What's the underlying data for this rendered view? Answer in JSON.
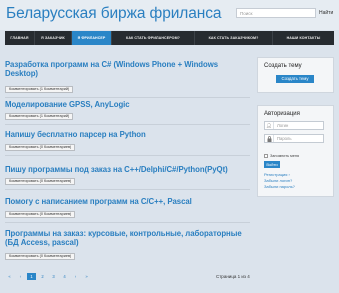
{
  "header": {
    "site_title": "Беларусская биржа фриланса",
    "search_placeholder": "Поиск",
    "search_button": "Найти"
  },
  "nav": {
    "items": [
      {
        "label": "ГЛАВНАЯ",
        "active": false
      },
      {
        "label": "Я ЗАКАЗЧИК",
        "active": false
      },
      {
        "label": "Я ФРИЛАНСЕР",
        "active": true
      },
      {
        "label": "КАК СТАТЬ ФРИЛАНСЕРОМ?",
        "active": false
      },
      {
        "label": "КАК СТАТЬ ЗАКАЗЧИКОМ?",
        "active": false
      },
      {
        "label": "НАШИ КОНТАКТЫ",
        "active": false
      }
    ]
  },
  "posts": [
    {
      "title": "Разработка программ на C# (Windows Phone + Windows Desktop)",
      "comments": "Комментировать (1 Комментарий)"
    },
    {
      "title": "Моделирование GPSS, AnyLogic",
      "comments": "Комментировать (1 Комментарий)"
    },
    {
      "title": "Напишу бесплатно парсер на Python",
      "comments": "Комментировать (0 Комментариев)"
    },
    {
      "title": "Пишу программы под заказ на C++/Delphi/C#/Python(PyQt)",
      "comments": "Комментировать (0 Комментариев)"
    },
    {
      "title": "Помогу с написанием программ на С/С++, Pascal",
      "comments": "Комментировать (0 Комментариев)"
    },
    {
      "title": "Программы на заказ: курсовые, контрольные, лабораторные (БД Access, pascal)",
      "comments": "Комментировать (0 Комментариев)"
    }
  ],
  "pagination": {
    "first": "«",
    "prev": "‹",
    "pages": [
      "1",
      "2",
      "3",
      "4"
    ],
    "current_page": "1",
    "next": "›",
    "last": "»",
    "info": "Страница 1 из 4"
  },
  "sidebar": {
    "create_topic": {
      "title": "Создать тему",
      "button": "Создать тему"
    },
    "auth": {
      "title": "Авторизация",
      "login_placeholder": "Логин",
      "password_placeholder": "Пароль",
      "remember": "Запомнить меня",
      "login_button": "Войти",
      "register": "Регистрация",
      "forgot_login": "Забыли логин?",
      "forgot_password": "Забыли пароль?"
    }
  },
  "colors": {
    "accent": "#2a86c8",
    "link": "#2a7fc0",
    "nav_bg": "#262b30",
    "page_bg": "#dbe3ec"
  },
  "icons": {
    "user": "user-icon",
    "lock": "lock-icon"
  }
}
